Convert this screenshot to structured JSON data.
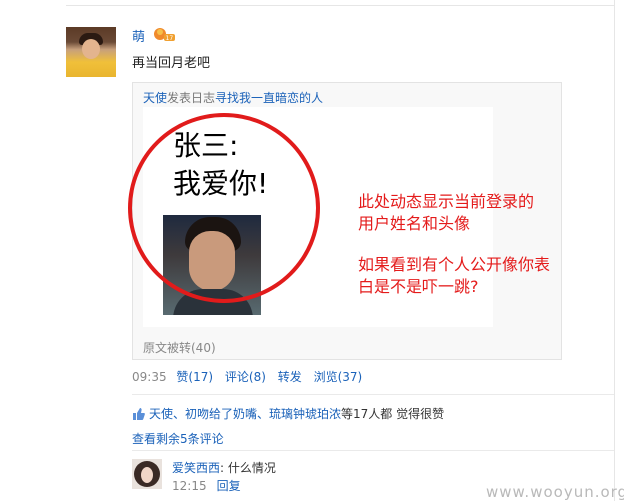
{
  "post": {
    "username": "萌",
    "text": "再当回月老吧"
  },
  "share": {
    "author": "天使",
    "action": "发表日志",
    "title": "寻找我一直暗恋的人",
    "big_line1": "张三:",
    "big_line2": "我爱你!",
    "forward_count": "原文被转(40)"
  },
  "annotation": {
    "line1": "此处动态显示当前登录的",
    "line2": "用户姓名和头像",
    "line3": "如果看到有个人公开像你表",
    "line4": "白是不是吓一跳?"
  },
  "meta": {
    "time": "09:35",
    "like": "赞(17)",
    "comment": "评论(8)",
    "forward": "转发",
    "views": "浏览(37)"
  },
  "likes": {
    "names": "天使、初吻给了奶嘴、琉璃钟琥珀浓",
    "suffix": "等17人都 觉得很赞"
  },
  "view_more": "查看剩余5条评论",
  "comment": {
    "name": "爱笑西西",
    "text": ": 什么情况",
    "time": "12:15",
    "reply": "回复"
  },
  "watermark": "www.wooyun.org",
  "colors": {
    "link": "#1b62b9",
    "annotation": "#e41b1b"
  }
}
